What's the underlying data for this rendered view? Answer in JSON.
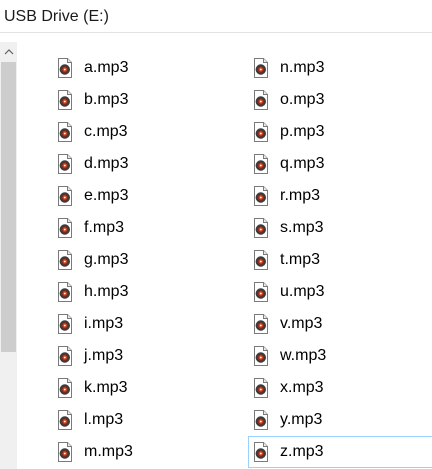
{
  "window": {
    "title": "USB Drive (E:)"
  },
  "icons": {
    "file": "audio-file-icon",
    "scroll_up": "chevron-up-icon"
  },
  "colors": {
    "selection_border": "#99d1ff",
    "scroll_track": "#f0f0f0",
    "scroll_thumb": "#cdcdcd"
  },
  "files": {
    "column1": [
      "a.mp3",
      "b.mp3",
      "c.mp3",
      "d.mp3",
      "e.mp3",
      "f.mp3",
      "g.mp3",
      "h.mp3",
      "i.mp3",
      "j.mp3",
      "k.mp3",
      "l.mp3",
      "m.mp3"
    ],
    "column2": [
      "n.mp3",
      "o.mp3",
      "p.mp3",
      "q.mp3",
      "r.mp3",
      "s.mp3",
      "t.mp3",
      "u.mp3",
      "v.mp3",
      "w.mp3",
      "x.mp3",
      "y.mp3",
      "z.mp3"
    ],
    "selected": "z.mp3"
  }
}
